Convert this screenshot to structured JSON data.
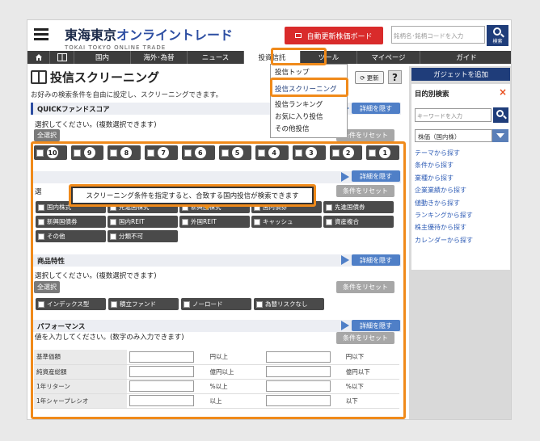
{
  "header": {
    "brand_jp": "東海東京",
    "brand_jp_blue": "オンライントレード",
    "brand_en": "TOKAI TOKYO ONLINE TRADE",
    "realtime_button": "自動更新株価ボード",
    "search_placeholder": "銘柄名･銘柄コードを入力",
    "search_button": "検索"
  },
  "nav": {
    "items": [
      "国内",
      "海外･為替",
      "ニュース",
      "投資信託",
      "ツール",
      "マイページ",
      "ガイド"
    ]
  },
  "dropdown": {
    "items": [
      "投信トップ",
      "投信スクリーニング",
      "投信ランキング",
      "お気に入り投信",
      "その他投信"
    ]
  },
  "page": {
    "title": "投信スクリーニング",
    "subtitle": "お好みの検索条件を自由に設定し、スクリーニングできます。",
    "update_button": "更新",
    "help_button": "?"
  },
  "quick": {
    "title": "QUICKファンドスコア",
    "desc": "選択してください。(複数選択できます)",
    "select_all": "全選択",
    "detail_hide": "詳細を隠す",
    "reset": "条件をリセット",
    "scores": [
      "10",
      "9",
      "8",
      "7",
      "6",
      "5",
      "4",
      "3",
      "2",
      "1"
    ]
  },
  "tooltip": "スクリーニング条件を指定すると、合致する国内投信が検索できます",
  "category": {
    "desc_prefix": "選",
    "detail_hide": "詳細を隠す",
    "reset": "条件をリセット",
    "items": [
      "国内株式",
      "先進国株式",
      "新興国株式",
      "国内債券",
      "先進国債券",
      "新興国債券",
      "国内REIT",
      "外国REIT",
      "キャッシュ",
      "資産複合",
      "その他",
      "分類不可"
    ]
  },
  "features": {
    "title": "商品特性",
    "desc": "選択してください。(複数選択できます)",
    "select_all": "全選択",
    "detail_hide": "詳細を隠す",
    "reset": "条件をリセット",
    "items": [
      "インデックス型",
      "積立ファンド",
      "ノーロード",
      "為替リスクなし"
    ]
  },
  "performance": {
    "title": "パフォーマンス",
    "desc": "値を入力してください。(数字のみ入力できます)",
    "detail_hide": "詳細を隠す",
    "reset": "条件をリセット",
    "rows": [
      {
        "label": "基準価額",
        "from_unit": "円以上",
        "to_unit": "円以下"
      },
      {
        "label": "純資産総額",
        "from_unit": "億円以上",
        "to_unit": "億円以下"
      },
      {
        "label": "1年リターン",
        "from_unit": "%以上",
        "to_unit": "%以下"
      },
      {
        "label": "1年シャープレシオ",
        "from_unit": "以上",
        "to_unit": "以下"
      }
    ]
  },
  "sidebar": {
    "gadget_button": "ガジェットを追加",
    "title": "目的別検索",
    "close": "×",
    "keyword_placeholder": "キーワードを入力",
    "select_value": "株価（国内株）",
    "links": [
      "テーマから探す",
      "条件から探す",
      "業種から探す",
      "企業業績から探す",
      "値動きから探す",
      "ランキングから探す",
      "株主優待から探す",
      "カレンダーから探す"
    ]
  },
  "colors": {
    "accent_orange": "#f08a1a",
    "navy": "#1f3d7a",
    "red": "#d92b2b",
    "button_blue": "#4f7fc7"
  }
}
